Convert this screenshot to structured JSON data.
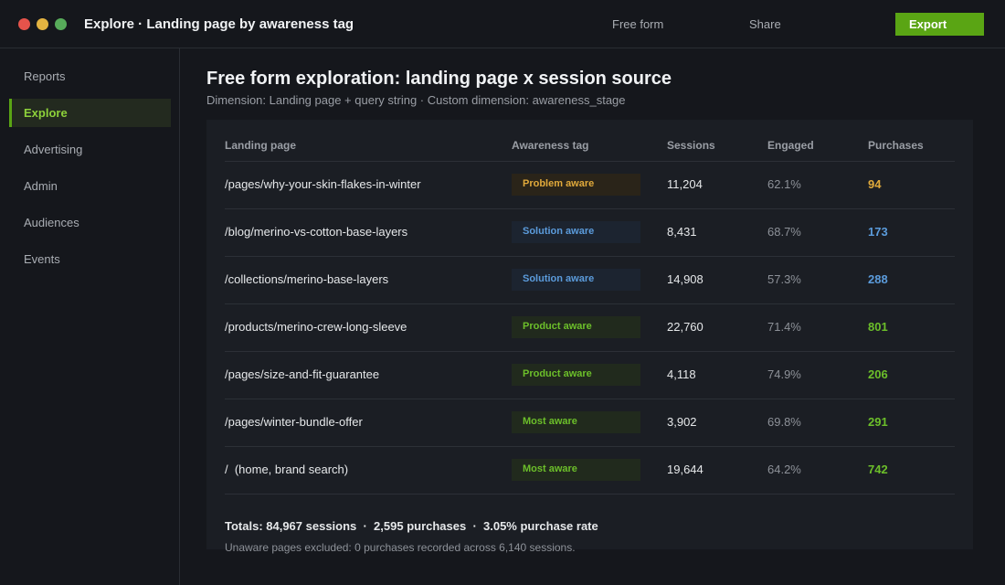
{
  "window": {
    "title": "Explore  ·  Landing page by awareness tag"
  },
  "toolbar": {
    "free_form_label": "Free form",
    "share_label": "Share",
    "export_label": "Export",
    "accent_color": "#5aa514"
  },
  "sidebar": {
    "items": [
      {
        "label": "Reports",
        "active": false
      },
      {
        "label": "Explore",
        "active": true
      },
      {
        "label": "Advertising",
        "active": false
      },
      {
        "label": "Admin",
        "active": false
      },
      {
        "label": "Audiences",
        "active": false
      },
      {
        "label": "Events",
        "active": false
      }
    ]
  },
  "main": {
    "title": "Free form exploration: landing page x session source",
    "subtitle": "Dimension: Landing page + query string  ·  Custom dimension: awareness_stage"
  },
  "table": {
    "headers": [
      "Landing page",
      "Awareness tag",
      "Sessions",
      "Engaged",
      "Purchases"
    ],
    "rows": [
      {
        "page": "/pages/why-your-skin-flakes-in-winter",
        "tag": "Problem aware",
        "sessions": "11,204",
        "engaged": "62.1%",
        "purchases": "94"
      },
      {
        "page": "/blog/merino-vs-cotton-base-layers",
        "tag": "Solution aware",
        "sessions": "8,431",
        "engaged": "68.7%",
        "purchases": "173"
      },
      {
        "page": "/collections/merino-base-layers",
        "tag": "Solution aware",
        "sessions": "14,908",
        "engaged": "57.3%",
        "purchases": "288"
      },
      {
        "page": "/products/merino-crew-long-sleeve",
        "tag": "Product aware",
        "sessions": "22,760",
        "engaged": "71.4%",
        "purchases": "801"
      },
      {
        "page": "/pages/size-and-fit-guarantee",
        "tag": "Product aware",
        "sessions": "4,118",
        "engaged": "74.9%",
        "purchases": "206"
      },
      {
        "page": "/pages/winter-bundle-offer",
        "tag": "Most aware",
        "sessions": "3,902",
        "engaged": "69.8%",
        "purchases": "291"
      },
      {
        "page": "/  (home, brand search)",
        "tag": "Most aware",
        "sessions": "19,644",
        "engaged": "64.2%",
        "purchases": "742"
      }
    ],
    "tag_colors": {
      "Problem aware": "#e0a93b",
      "Solution aware": "#5b9bdb",
      "Product aware": "#6cbf2a",
      "Most aware": "#6cbf2a"
    }
  },
  "summary": {
    "totals": "Totals: 84,967 sessions  ·  2,595 purchases  ·  3.05% purchase rate",
    "footnote": "Unaware pages excluded: 0 purchases recorded across 6,140 sessions."
  }
}
